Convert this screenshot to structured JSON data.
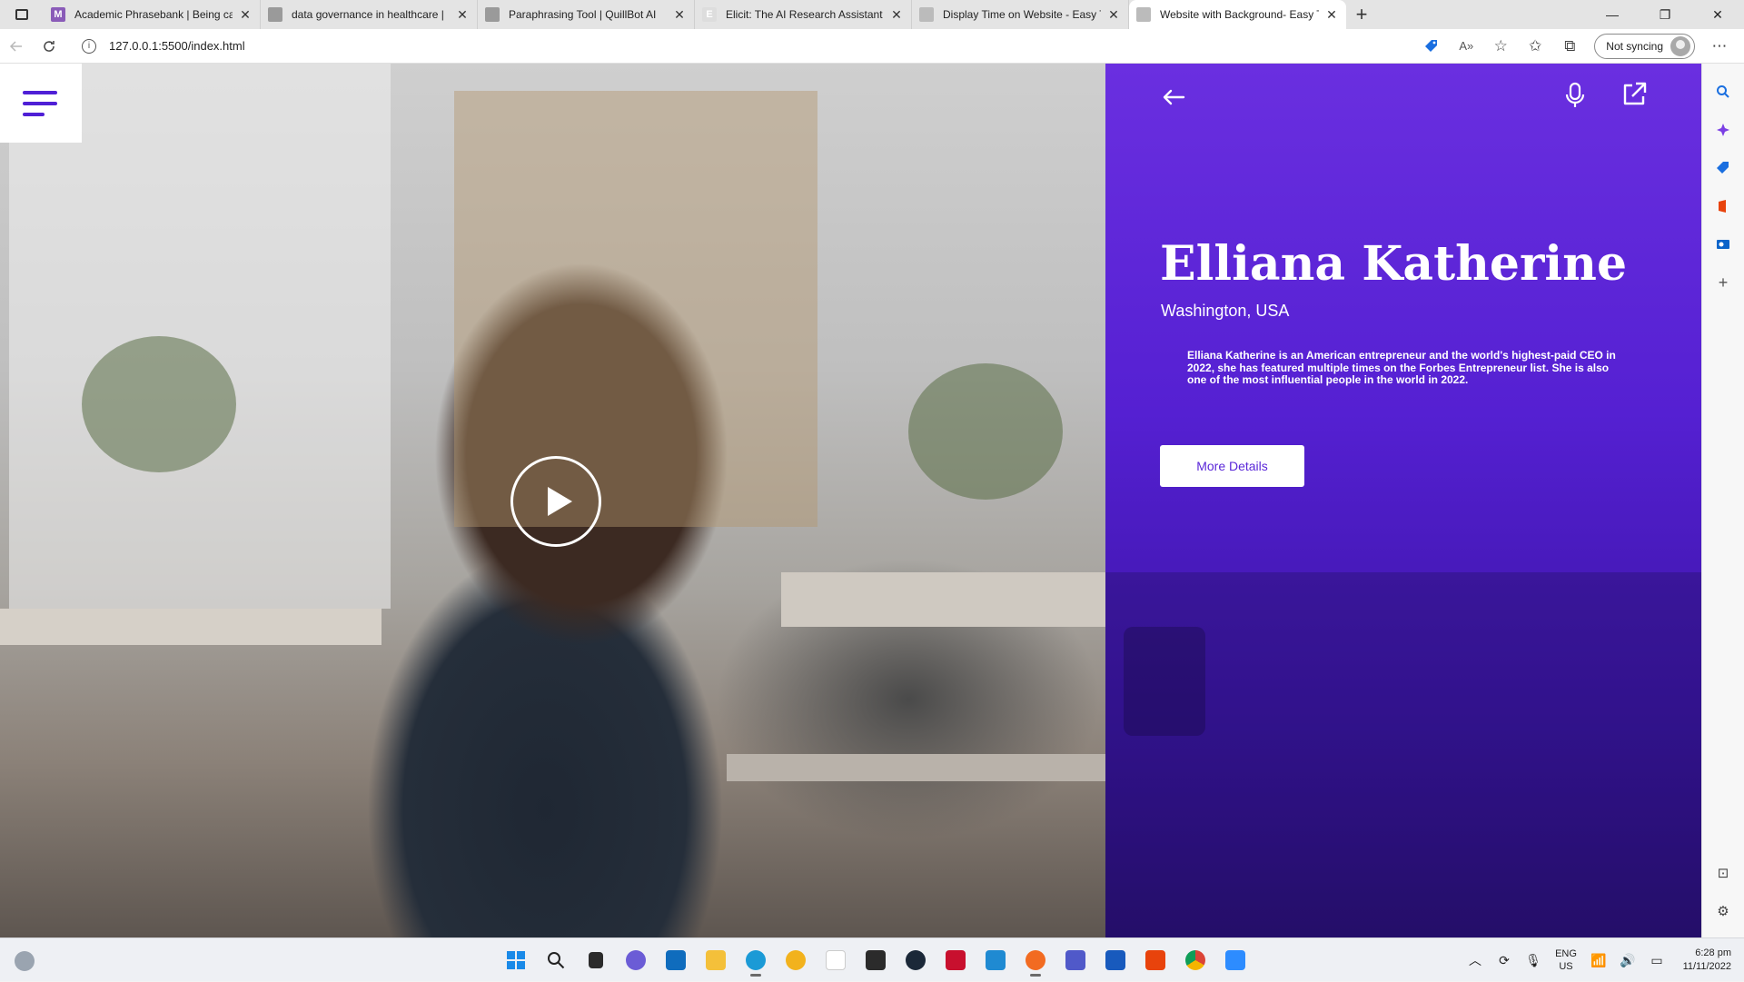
{
  "browser": {
    "tabs": [
      {
        "title": "Academic Phrasebank | Being ca",
        "favicon_letter": "M",
        "favicon_color": "#8a5bb8",
        "active": false
      },
      {
        "title": "data governance in healthcare |",
        "favicon_letter": "",
        "favicon_color": "#9a9a9a",
        "active": false
      },
      {
        "title": "Paraphrasing Tool | QuillBot AI",
        "favicon_letter": "",
        "favicon_color": "#9a9a9a",
        "active": false
      },
      {
        "title": "Elicit: The AI Research Assistant",
        "favicon_letter": "E",
        "favicon_color": "#dddddd",
        "active": false
      },
      {
        "title": "Display Time on Website - Easy T",
        "favicon_letter": "",
        "favicon_color": "#bbbbbb",
        "active": false
      },
      {
        "title": "Website with Background- Easy T",
        "favicon_letter": "",
        "favicon_color": "#bbbbbb",
        "active": true
      }
    ],
    "new_tab_label": "+",
    "url": "127.0.0.1:5500/index.html",
    "sync_label": "Not syncing",
    "window_controls": {
      "minimize": "—",
      "restore": "❐",
      "close": "✕"
    }
  },
  "page": {
    "profile": {
      "name": "Elliana Katherine",
      "location": "Washington, USA",
      "bio": "Elliana Katherine is an American entrepreneur and the world's highest-paid CEO in 2022, she has featured multiple times on the Forbes Entrepreneur list. She is also one of the most influential people in the world in 2022.",
      "cta_label": "More Details"
    },
    "accent_color": "#5a27d8",
    "icons": [
      "menu-icon",
      "play-icon",
      "back-arrow-icon",
      "microphone-icon",
      "external-link-icon"
    ]
  },
  "taskbar": {
    "lang_line1": "ENG",
    "lang_line2": "US",
    "time": "6:28 pm",
    "date": "11/11/2022"
  }
}
